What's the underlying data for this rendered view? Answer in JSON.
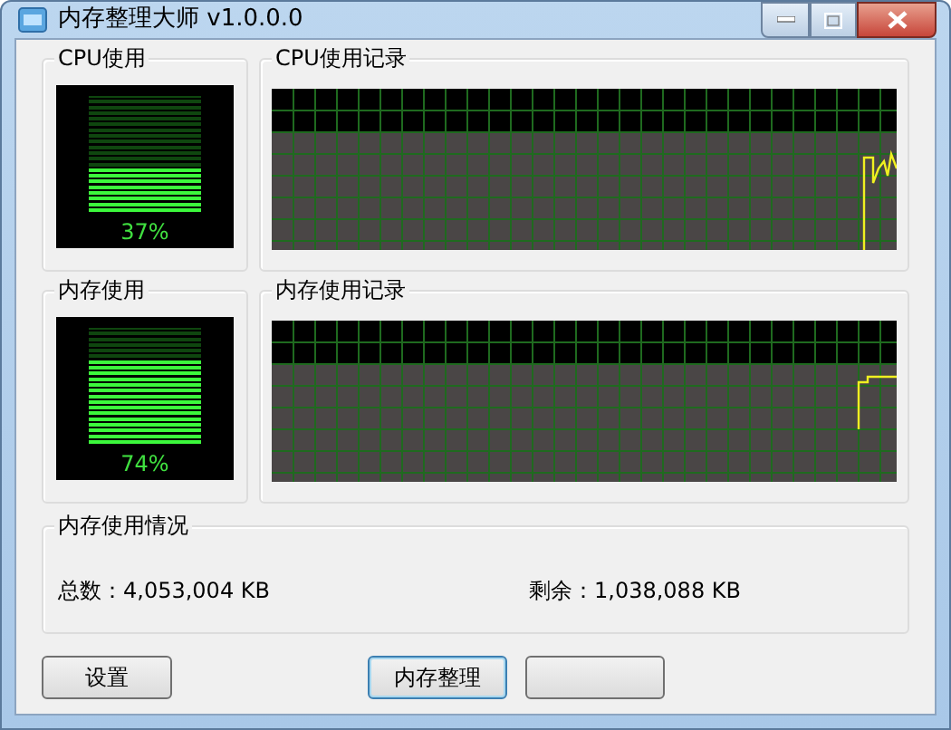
{
  "window": {
    "title": "内存整理大师 v1.0.0.0"
  },
  "cpu": {
    "label": "CPU使用",
    "level": 0.37,
    "reading": "37%"
  },
  "cpu_history": {
    "label": "CPU使用记录"
  },
  "memory": {
    "label": "内存使用",
    "level": 0.74,
    "reading": "74%"
  },
  "memory_history": {
    "label": "内存使用记录"
  },
  "memory_info": {
    "label": "内存使用情况",
    "total": "总数：4,053,004 KB",
    "free": "剩余：1,038,088 KB"
  },
  "buttons": [
    {
      "label": "设置",
      "default": false
    },
    {
      "label": "内存整理",
      "default": true
    }
  ]
}
